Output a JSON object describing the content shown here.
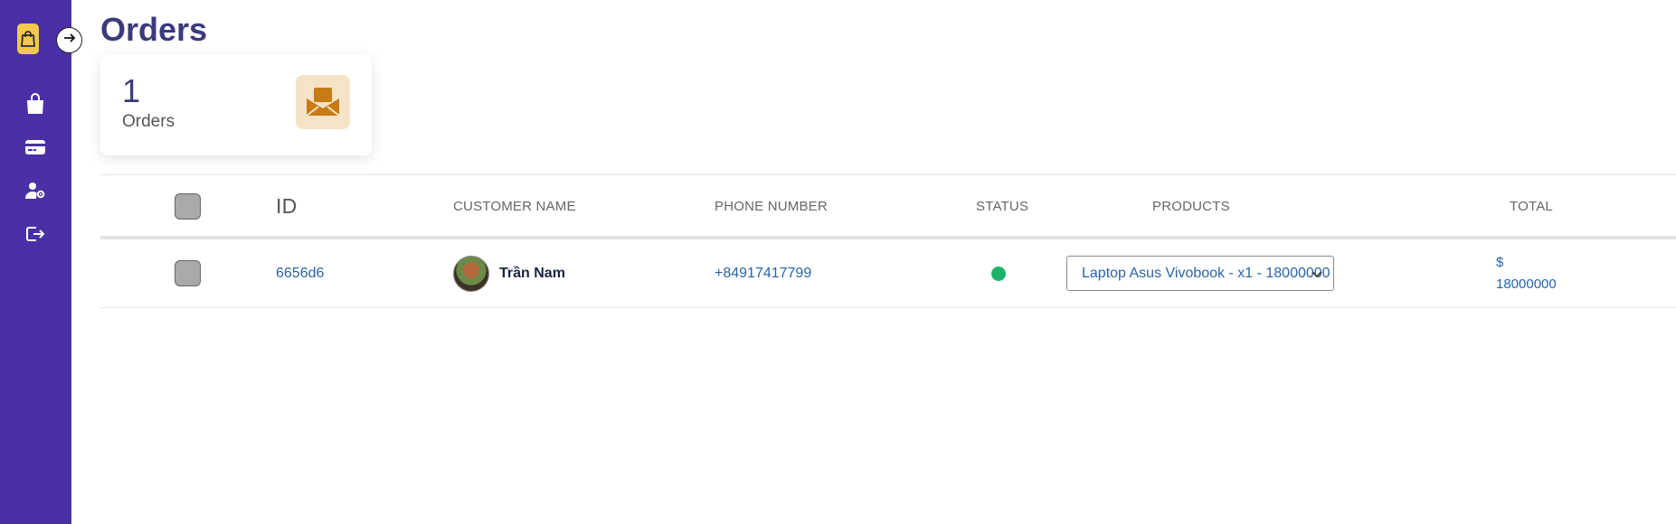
{
  "page": {
    "title": "Orders"
  },
  "sidebar": {
    "logo_icon": "shopping-bag-icon",
    "collapse_icon": "arrow-right-icon",
    "items": [
      {
        "icon": "bag-icon"
      },
      {
        "icon": "credit-card-icon"
      },
      {
        "icon": "user-settings-icon"
      },
      {
        "icon": "logout-icon"
      }
    ]
  },
  "stats": {
    "value": "1",
    "label": "Orders",
    "icon": "envelope-open-icon"
  },
  "table": {
    "headers": {
      "id": "ID",
      "customer": "CUSTOMER NAME",
      "phone": "PHONE NUMBER",
      "status": "STATUS",
      "products": "PRODUCTS",
      "total": "TOTAL"
    },
    "rows": [
      {
        "id": "6656d6",
        "customer": "Trần Nam",
        "phone": "+84917417799",
        "status": "green",
        "product": "Laptop Asus Vivobook - x1 - 18000000",
        "total_currency": "$",
        "total_value": "18000000"
      }
    ]
  },
  "colors": {
    "sidebar": "#4a2fa6",
    "accent": "#f2c94c",
    "title": "#3b3a7a",
    "link": "#2a63a8",
    "status_ok": "#1db26a"
  }
}
